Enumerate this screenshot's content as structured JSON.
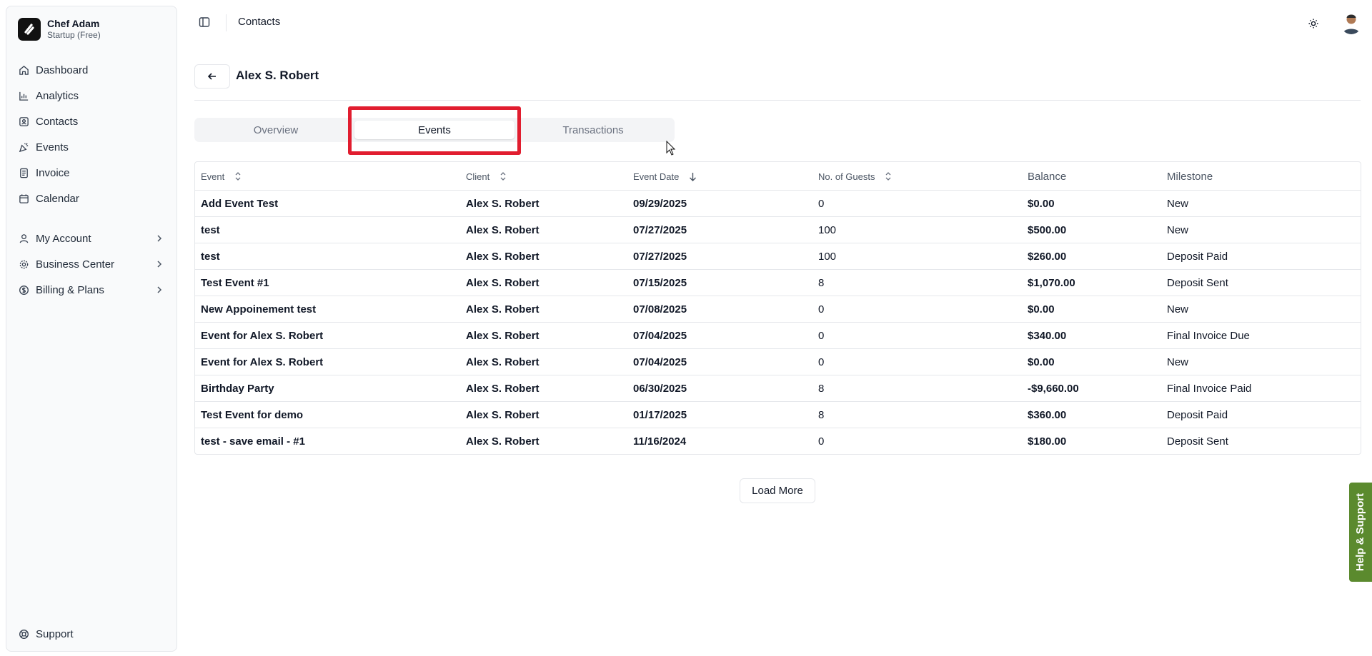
{
  "brand": {
    "name": "Chef Adam",
    "plan": "Startup (Free)"
  },
  "sidebar": {
    "items": [
      {
        "label": "Dashboard",
        "icon": "home-icon"
      },
      {
        "label": "Analytics",
        "icon": "bar-chart-icon"
      },
      {
        "label": "Contacts",
        "icon": "contact-card-icon"
      },
      {
        "label": "Events",
        "icon": "party-popper-icon"
      },
      {
        "label": "Invoice",
        "icon": "document-icon"
      },
      {
        "label": "Calendar",
        "icon": "calendar-icon"
      }
    ],
    "groups": [
      {
        "label": "My Account",
        "icon": "user-icon"
      },
      {
        "label": "Business Center",
        "icon": "gear-icon"
      },
      {
        "label": "Billing & Plans",
        "icon": "dollar-circle-icon"
      }
    ],
    "support": {
      "label": "Support",
      "icon": "lifebuoy-icon"
    }
  },
  "topbar": {
    "title": "Contacts"
  },
  "contact": {
    "name": "Alex S. Robert"
  },
  "tabs": [
    "Overview",
    "Events",
    "Transactions"
  ],
  "table": {
    "headers": [
      "Event",
      "Client",
      "Event Date",
      "No. of Guests",
      "Balance",
      "Milestone"
    ],
    "rows": [
      [
        "Add Event Test",
        "Alex S. Robert",
        "09/29/2025",
        "0",
        "$0.00",
        "New"
      ],
      [
        "test",
        "Alex S. Robert",
        "07/27/2025",
        "100",
        "$500.00",
        "New"
      ],
      [
        "test",
        "Alex S. Robert",
        "07/27/2025",
        "100",
        "$260.00",
        "Deposit Paid"
      ],
      [
        "Test Event #1",
        "Alex S. Robert",
        "07/15/2025",
        "8",
        "$1,070.00",
        "Deposit Sent"
      ],
      [
        "New Appoinement test",
        "Alex S. Robert",
        "07/08/2025",
        "0",
        "$0.00",
        "New"
      ],
      [
        "Event for Alex S. Robert",
        "Alex S. Robert",
        "07/04/2025",
        "0",
        "$340.00",
        "Final Invoice Due"
      ],
      [
        "Event for Alex S. Robert",
        "Alex S. Robert",
        "07/04/2025",
        "0",
        "$0.00",
        "New"
      ],
      [
        "Birthday Party",
        "Alex S. Robert",
        "06/30/2025",
        "8",
        "-$9,660.00",
        "Final Invoice Paid"
      ],
      [
        "Test Event for demo",
        "Alex S. Robert",
        "01/17/2025",
        "8",
        "$360.00",
        "Deposit Paid"
      ],
      [
        "test - save email - #1",
        "Alex S. Robert",
        "11/16/2024",
        "0",
        "$180.00",
        "Deposit Sent"
      ]
    ]
  },
  "load_more": "Load More",
  "help": "Help & Support",
  "colors": {
    "highlight": "#e11d2f",
    "help_tab": "#5b8a2e"
  }
}
